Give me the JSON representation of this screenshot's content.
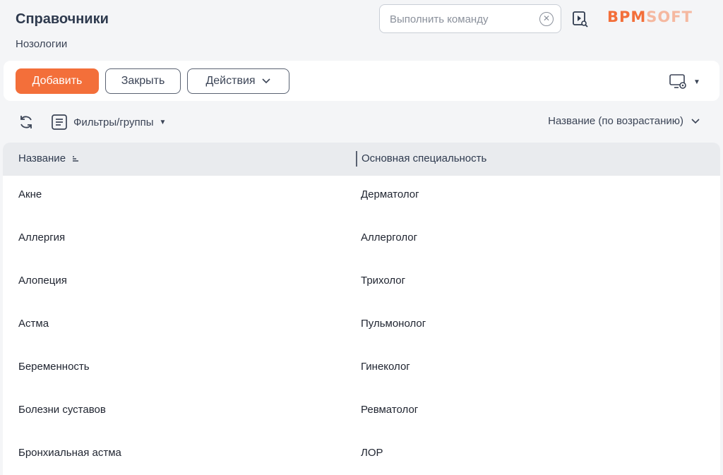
{
  "header": {
    "title": "Справочники",
    "subtitle": "Нозологии",
    "command_placeholder": "Выполнить команду",
    "logo_primary": "BPM",
    "logo_secondary": "SOFT",
    "brand_color": "#f36f3a"
  },
  "toolbar": {
    "add_label": "Добавить",
    "close_label": "Закрыть",
    "actions_label": "Действия"
  },
  "filters": {
    "filter_label": "Фильтры/группы",
    "sort_label": "Название (по возрастанию)"
  },
  "grid": {
    "columns": [
      "Название",
      "Основная специальность"
    ],
    "rows": [
      [
        "Акне",
        "Дерматолог"
      ],
      [
        "Аллергия",
        "Аллерголог"
      ],
      [
        "Алопеция",
        "Трихолог"
      ],
      [
        "Астма",
        "Пульмонолог"
      ],
      [
        "Беременность",
        "Гинеколог"
      ],
      [
        "Болезни суставов",
        "Ревматолог"
      ],
      [
        "Бронхиальная астма",
        "ЛОР"
      ]
    ]
  },
  "icons": [
    "clear-icon",
    "video-help-icon",
    "view-settings-icon",
    "refresh-icon",
    "filter-icon",
    "sort-asc-icon",
    "chevron-down-icon"
  ]
}
